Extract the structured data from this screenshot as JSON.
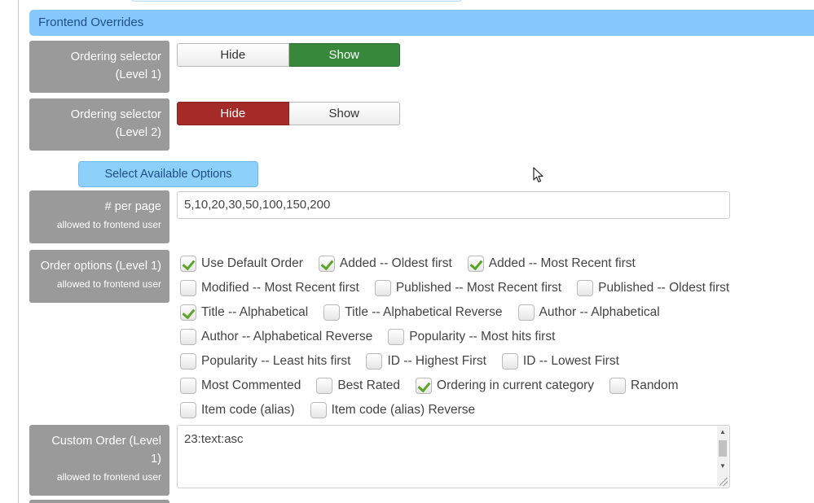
{
  "section": {
    "title": "Frontend Overrides"
  },
  "ordering_level1": {
    "label_line1": "Ordering selector",
    "label_line2": "(Level 1)",
    "hide_label": "Hide",
    "show_label": "Show",
    "selected": "Show"
  },
  "ordering_level2": {
    "label_line1": "Ordering selector",
    "label_line2": "(Level 2)",
    "hide_label": "Hide",
    "show_label": "Show",
    "selected": "Hide"
  },
  "select_options_button": "Select Available Options",
  "per_page": {
    "label": "# per page",
    "sublabel": "allowed to frontend user",
    "value": "5,10,20,30,50,100,150,200"
  },
  "order_options": {
    "label": "Order options (Level 1)",
    "sublabel": "allowed to frontend user",
    "rows": [
      [
        {
          "label": "Use Default Order",
          "checked": true
        },
        {
          "label": "Added -- Oldest first",
          "checked": true
        },
        {
          "label": "Added -- Most Recent first",
          "checked": true
        }
      ],
      [
        {
          "label": "Modified -- Most Recent first",
          "checked": false
        },
        {
          "label": "Published -- Most Recent first",
          "checked": false
        },
        {
          "label": "Published -- Oldest first",
          "checked": false
        }
      ],
      [
        {
          "label": "Title -- Alphabetical",
          "checked": true
        },
        {
          "label": "Title -- Alphabetical Reverse",
          "checked": false
        },
        {
          "label": "Author -- Alphabetical",
          "checked": false
        }
      ],
      [
        {
          "label": "Author -- Alphabetical Reverse",
          "checked": false
        },
        {
          "label": "Popularity -- Most hits first",
          "checked": false
        }
      ],
      [
        {
          "label": "Popularity -- Least hits first",
          "checked": false
        },
        {
          "label": "ID -- Highest First",
          "checked": false
        },
        {
          "label": "ID -- Lowest First",
          "checked": false
        }
      ],
      [
        {
          "label": "Most Commented",
          "checked": false
        },
        {
          "label": "Best Rated",
          "checked": false
        },
        {
          "label": "Ordering in current category",
          "checked": true
        },
        {
          "label": "Random",
          "checked": false
        }
      ],
      [
        {
          "label": "Item code (alias)",
          "checked": false
        },
        {
          "label": "Item code (alias) Reverse",
          "checked": false
        }
      ]
    ]
  },
  "custom_order": {
    "label_line1": "Custom Order (Level",
    "label_line2": "1)",
    "sublabel": "allowed to frontend user",
    "value": "23:text:asc"
  },
  "icons": {
    "checkmark": "check-icon",
    "scroll_up": "arrow-up-icon",
    "scroll_down": "arrow-down-icon",
    "cursor": "mouse-pointer-icon"
  }
}
